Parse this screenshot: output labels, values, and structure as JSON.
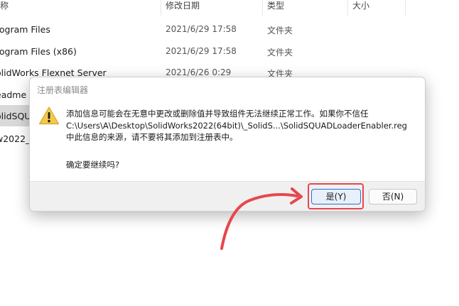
{
  "explorer": {
    "columns": {
      "name": "称",
      "modified": "修改日期",
      "type": "类型",
      "size": "大小"
    },
    "rows": [
      {
        "name": "rogram Files",
        "date": "2021/6/29 17:58",
        "type": "文件夹"
      },
      {
        "name": "rogram Files (x86)",
        "date": "2021/6/29 17:58",
        "type": "文件夹"
      },
      {
        "name": "olidWorks Flexnet Server",
        "date": "2021/6/26 0:29",
        "type": "文件夹"
      },
      {
        "name": "eadme",
        "date": "",
        "type": ""
      },
      {
        "name": "olidSQU",
        "date": "",
        "type": ""
      },
      {
        "name": "w2022_",
        "date": "",
        "type": ""
      }
    ]
  },
  "dialog": {
    "title": "注册表编辑器",
    "message_lines": [
      "添加信息可能会在无意中更改或删除值并导致组件无法继续正常工作。如果你不信任",
      "C:\\Users\\A\\Desktop\\SolidWorks2022(64bit)\\_SolidS...\\SolidSQUADLoaderEnabler.reg",
      "中此信息的来源，请不要将其添加到注册表中。"
    ],
    "confirm": "确定要继续吗?",
    "yes_label": "是(Y)",
    "no_label": "否(N)"
  },
  "colors": {
    "highlight": "#e6474d",
    "warning": "#f2c94c",
    "accent": "#2b6fd1"
  }
}
